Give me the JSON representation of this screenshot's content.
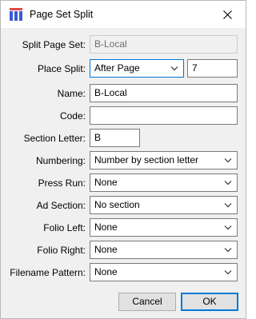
{
  "window": {
    "title": "Page Set Split",
    "icon": "app-grid-icon",
    "close_icon": "close-icon"
  },
  "fields": {
    "split_page_set": {
      "label": "Split Page Set:",
      "value": "B-Local"
    },
    "place_split": {
      "label": "Place Split:",
      "value": "After Page",
      "page": "7"
    },
    "name": {
      "label": "Name:",
      "value": "B-Local"
    },
    "code": {
      "label": "Code:",
      "value": ""
    },
    "section_letter": {
      "label": "Section Letter:",
      "value": "B"
    },
    "numbering": {
      "label": "Numbering:",
      "value": "Number by section letter"
    },
    "press_run": {
      "label": "Press Run:",
      "value": "None"
    },
    "ad_section": {
      "label": "Ad Section:",
      "value": "No section"
    },
    "folio_left": {
      "label": "Folio Left:",
      "value": "None"
    },
    "folio_right": {
      "label": "Folio Right:",
      "value": "None"
    },
    "filename_pattern": {
      "label": "Filename Pattern:",
      "value": "None"
    }
  },
  "buttons": {
    "cancel": "Cancel",
    "ok": "OK"
  },
  "colors": {
    "accent": "#0078d7",
    "dialog_bg": "#f0f0f0"
  }
}
